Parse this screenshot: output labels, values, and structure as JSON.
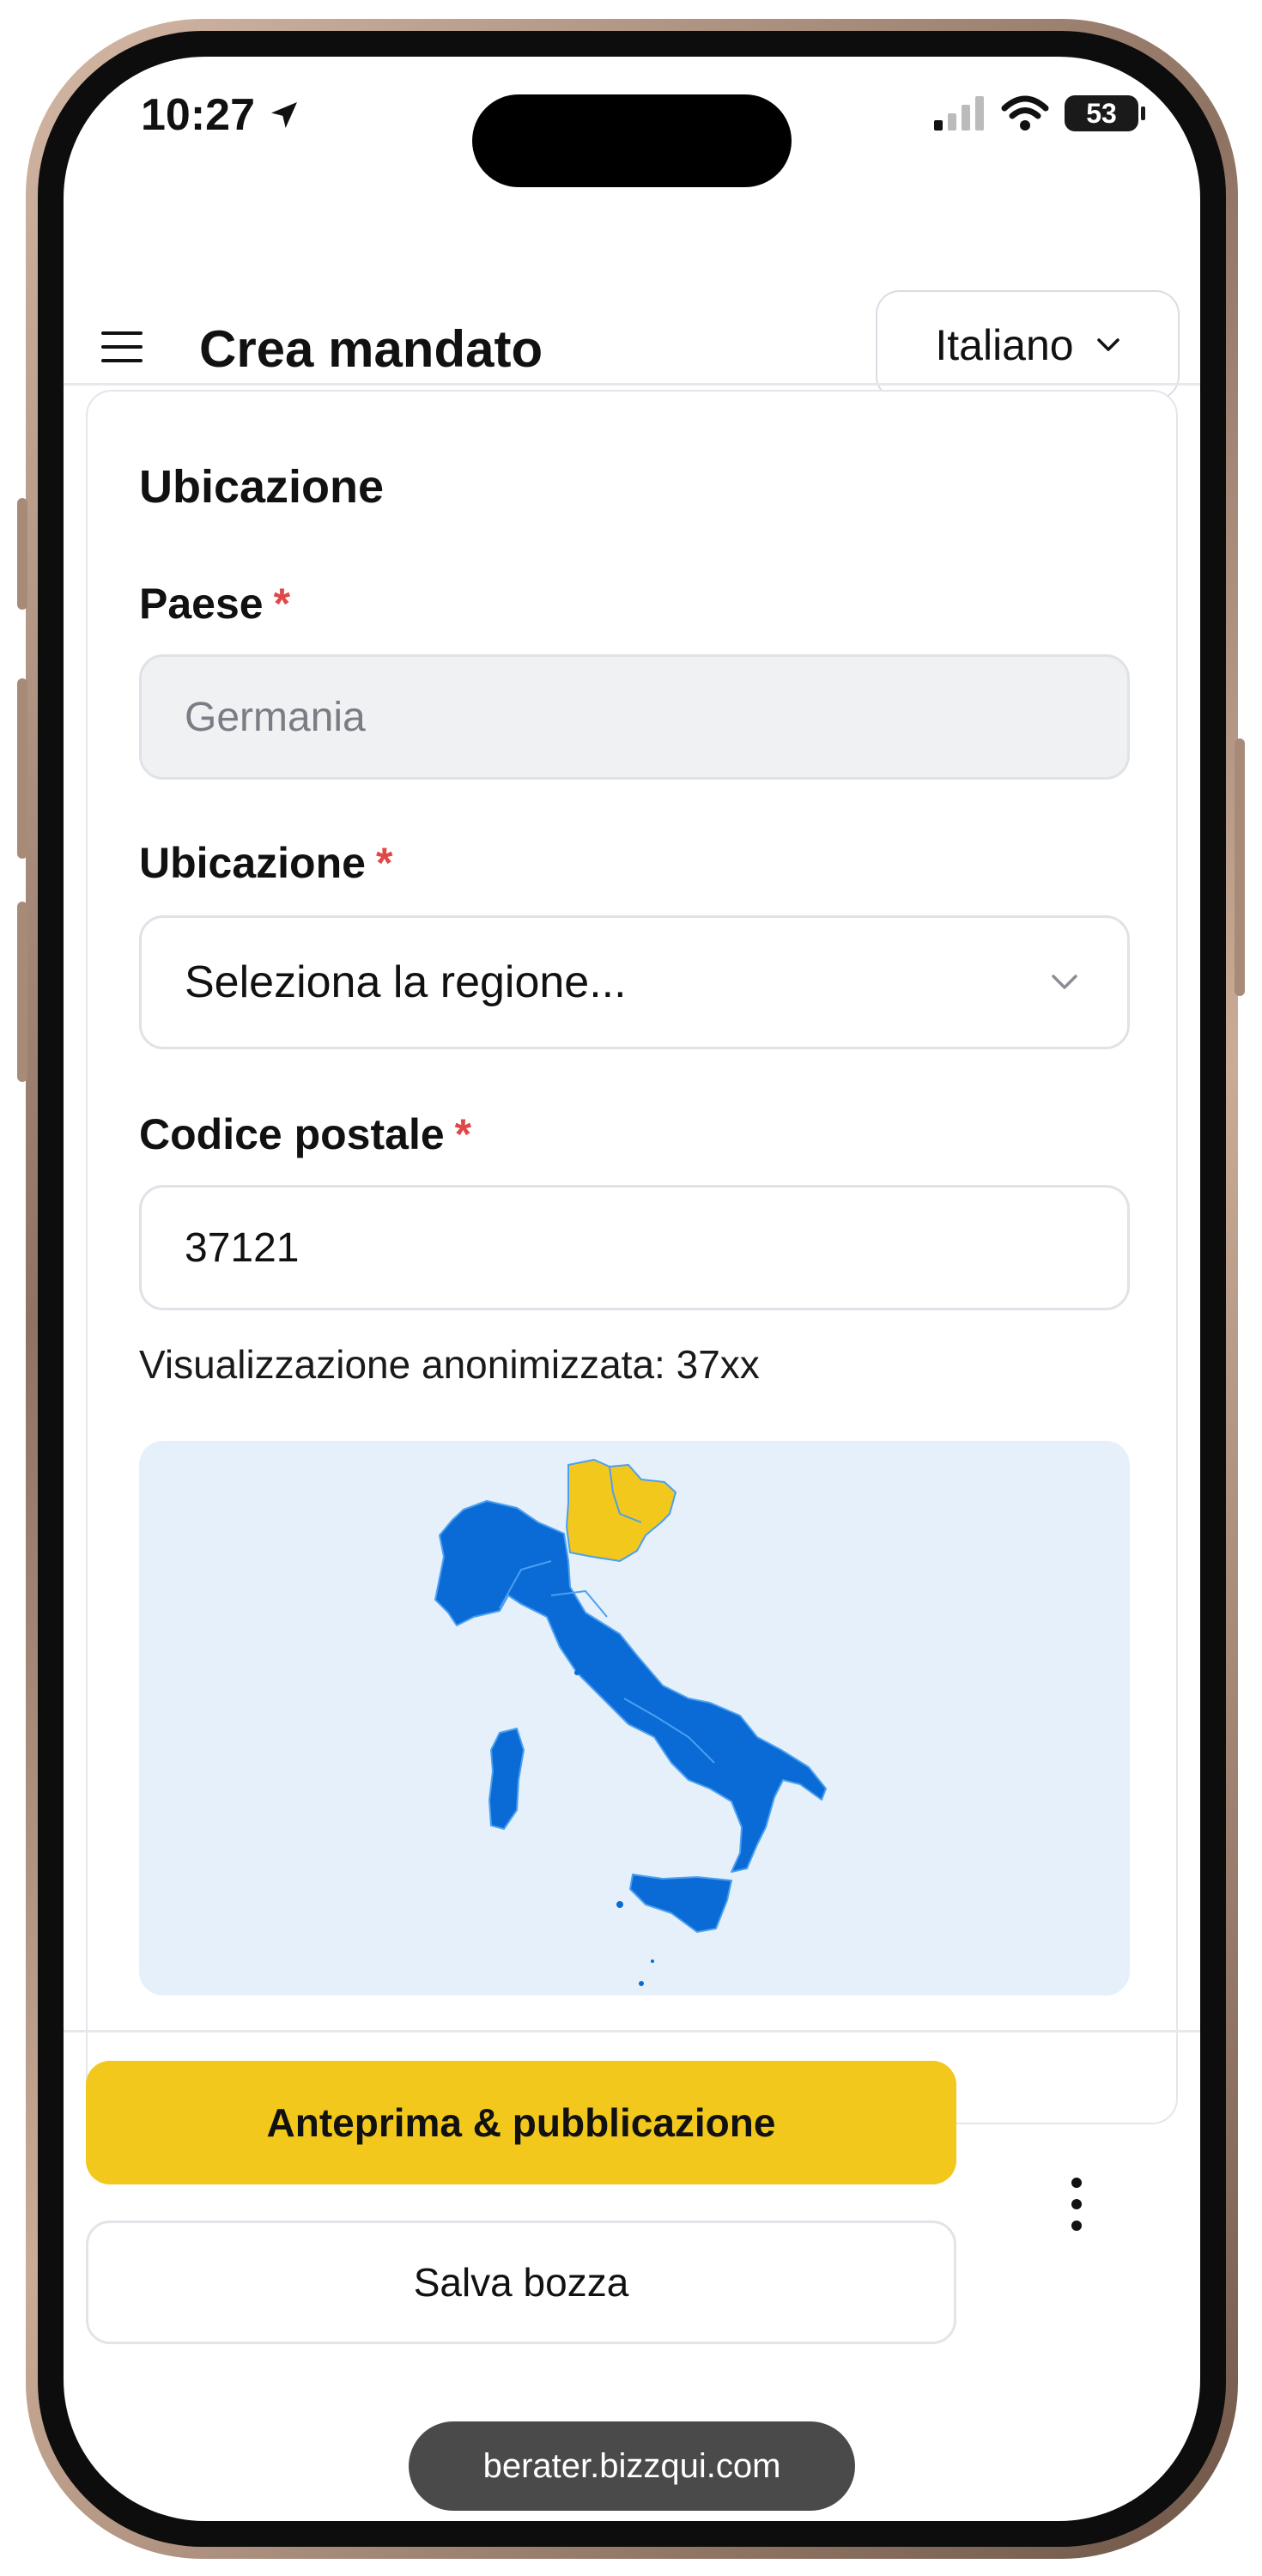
{
  "status_bar": {
    "time": "10:27",
    "battery": "53"
  },
  "header": {
    "title": "Crea mandato",
    "language": "Italiano"
  },
  "section": {
    "title": "Ubicazione"
  },
  "form": {
    "country_label": "Paese",
    "country_value": "Germania",
    "location_label": "Ubicazione",
    "location_placeholder": "Seleziona la regione...",
    "postal_label": "Codice postale",
    "postal_value": "37121",
    "anonymized_note": "Visualizzazione anonimizzata: 37xx",
    "required_mark": "*"
  },
  "map": {
    "base_color": "#0a6ad6",
    "highlight_color": "#f2c81d",
    "background": "#e6f0fb"
  },
  "actions": {
    "primary_label": "Anteprima & pubblicazione",
    "secondary_label": "Salva bozza"
  },
  "browser": {
    "url": "berater.bizzqui.com"
  },
  "colors": {
    "accent": "#f2c81d",
    "required": "#e04848"
  }
}
